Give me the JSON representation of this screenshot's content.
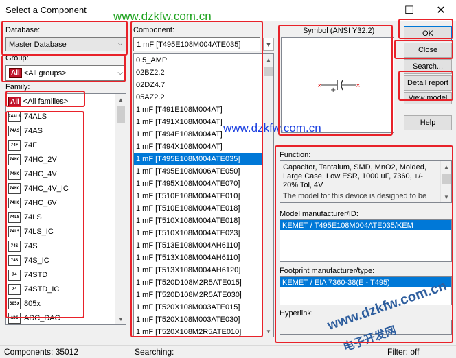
{
  "window": {
    "title": "Select a Component",
    "close_glyph": "✕",
    "max_glyph": "☐"
  },
  "watermarks": {
    "top": "www.dzkfw.com.cn",
    "mid": "www.dzkfw.com.cn",
    "bottom": "www.dzkfw.com.cn",
    "cn": "电子开发网"
  },
  "database": {
    "label": "Database:",
    "value": "Master Database"
  },
  "group": {
    "label": "Group:",
    "badge": "All",
    "value": "<All groups>"
  },
  "family": {
    "label": "Family:",
    "all_item": {
      "badge": "All",
      "label": "<All families>"
    },
    "items": [
      {
        "icon": "74ALS",
        "label": "74ALS"
      },
      {
        "icon": "74AS",
        "label": "74AS"
      },
      {
        "icon": "74F",
        "label": "74F"
      },
      {
        "icon": "74HC",
        "label": "74HC_2V"
      },
      {
        "icon": "74HC",
        "label": "74HC_4V"
      },
      {
        "icon": "74HC",
        "label": "74HC_4V_IC"
      },
      {
        "icon": "74HC",
        "label": "74HC_6V"
      },
      {
        "icon": "74LS",
        "label": "74LS"
      },
      {
        "icon": "74LS",
        "label": "74LS_IC"
      },
      {
        "icon": "74S",
        "label": "74S"
      },
      {
        "icon": "74S",
        "label": "74S_IC"
      },
      {
        "icon": "74",
        "label": "74STD"
      },
      {
        "icon": "74",
        "label": "74STD_IC"
      },
      {
        "icon": "805x",
        "label": "805x"
      },
      {
        "icon": "ADC",
        "label": "ADC_DAC"
      }
    ]
  },
  "component": {
    "label": "Component:",
    "search_value": "1 mF  [T495E108M004ATE035]",
    "items": [
      "0.5_AMP",
      "02BZ2.2",
      "02DZ4.7",
      "05AZ2.2",
      "1 mF  [T491E108M004AT]",
      "1 mF  [T491X108M004AT]",
      "1 mF  [T494E108M004AT]",
      "1 mF  [T494X108M004AT]",
      "1 mF  [T495E108M004ATE035]",
      "1 mF  [T495E108M006ATE050]",
      "1 mF  [T495X108M004ATE070]",
      "1 mF  [T510E108M004ATE010]",
      "1 mF  [T510E108M004ATE018]",
      "1 mF  [T510X108M004ATE018]",
      "1 mF  [T510X108M004ATE023]",
      "1 mF  [T513E108M004AH6110]",
      "1 mF  [T513X108M004AH6110]",
      "1 mF  [T513X108M004AH6120]",
      "1 mF  [T520D108M2R5ATE015]",
      "1 mF  [T520D108M2R5ATE030]",
      "1 mF  [T520X108M003ATE015]",
      "1 mF  [T520X108M003ATE030]",
      "1 mF  [T520X108M2R5ATE010]"
    ],
    "selected_index": 8
  },
  "symbol": {
    "label": "Symbol (ANSI Y32.2)"
  },
  "buttons": {
    "ok": "OK",
    "close": "Close",
    "search": "Search...",
    "detail": "Detail report",
    "model": "View model",
    "help": "Help"
  },
  "function": {
    "label": "Function:",
    "text": "Capacitor, Tantalum, SMD, MnO2, Molded, Large Case, Low ESR, 1000 uF, 7360, +/- 20% Tol, 4V",
    "text_more": "The model for this device is designed to be"
  },
  "model_mfr": {
    "label": "Model manufacturer/ID:",
    "value": "KEMET / T495E108M004ATE035/KEM"
  },
  "footprint": {
    "label": "Footprint manufacturer/type:",
    "value": "KEMET / EIA 7360-38(E - T495)"
  },
  "hyperlink": {
    "label": "Hyperlink:"
  },
  "status": {
    "components": "Components: 35012",
    "searching": "Searching:",
    "filter": "Filter: off"
  },
  "colors": {
    "highlight": "#0078d7",
    "annotation_red": "#e8222a",
    "badge_red": "#c0132a"
  }
}
